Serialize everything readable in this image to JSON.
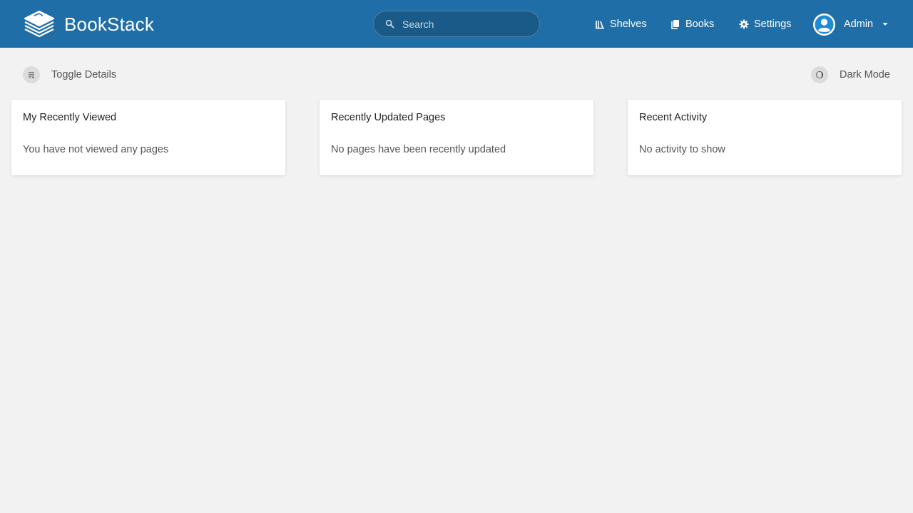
{
  "header": {
    "brand_name": "BookStack",
    "search": {
      "placeholder": "Search"
    },
    "nav": {
      "shelves": "Shelves",
      "books": "Books",
      "settings": "Settings"
    },
    "user": {
      "name": "Admin"
    },
    "colors": {
      "primary": "#206ea7"
    }
  },
  "actions": {
    "toggle_details": "Toggle Details",
    "dark_mode": "Dark Mode"
  },
  "cards": [
    {
      "title": "My Recently Viewed",
      "body": "You have not viewed any pages"
    },
    {
      "title": "Recently Updated Pages",
      "body": "No pages have been recently updated"
    },
    {
      "title": "Recent Activity",
      "body": "No activity to show"
    }
  ],
  "icons": {
    "logo": "bookstack-logo-icon",
    "search": "search-icon",
    "shelves": "shelves-icon",
    "books": "books-icon",
    "settings": "gear-icon",
    "user": "user-avatar-icon",
    "caret": "caret-down-icon",
    "toggle_details": "toggle-details-icon",
    "dark_mode": "dark-mode-icon"
  }
}
